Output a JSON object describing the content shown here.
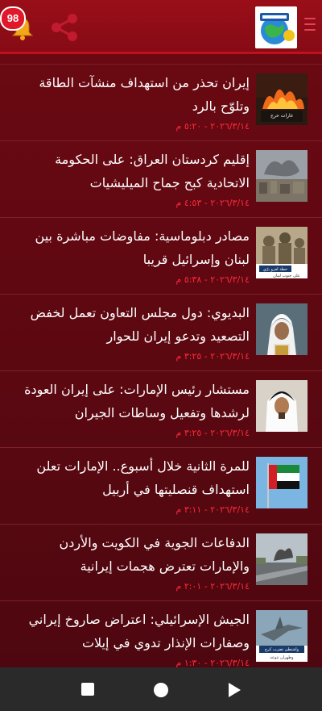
{
  "header": {
    "notifications_count": "98",
    "logo_label": "logo"
  },
  "news": [
    {
      "title": "إيران تحذر من استهداف منشآت الطاقة وتلوّح بالرد",
      "date": "٢٠٢٦/٣/١٤ - ٥:٢٠ م",
      "thumb": "fire-scene",
      "thumb_caption": "غارات حرج"
    },
    {
      "title": "إقليم كردستان العراق: على الحكومة الاتحادية كبح جماح الميليشيات",
      "date": "٢٠٢٦/٣/١٤ - ٤:٥٣ م",
      "thumb": "smoke-city"
    },
    {
      "title": "مصادر دبلوماسية: مفاوضات مباشرة بين لبنان وإسرائيل قريبا",
      "date": "٢٠٢٦/٣/١٤ - ٥:٣٨ م",
      "thumb": "soldiers",
      "thumb_caption": "خطة لغزو برّي",
      "thumb_caption2": "على جنوب لبنان"
    },
    {
      "title": "البديوي: دول مجلس التعاون تعمل لخفض التصعيد وتدعو إيران للحوار",
      "date": "٢٠٢٦/٣/١٤ - ٣:٢٥ م",
      "thumb": "portrait-ghutra"
    },
    {
      "title": "مستشار رئيس الإمارات: على إيران العودة لرشدها وتفعيل وساطات الجيران",
      "date": "٢٠٢٦/٣/١٤ - ٣:٢٥ م",
      "thumb": "portrait-white"
    },
    {
      "title": "للمرة الثانية خلال أسبوع.. الإمارات تعلن استهداف قنصليتها في أربيل",
      "date": "٢٠٢٦/٣/١٤ - ٣:١١ م",
      "thumb": "uae-flag"
    },
    {
      "title": "الدفاعات الجوية في الكويت والأردن والإمارات تعترض هجمات إيرانية",
      "date": "٢٠٢٦/٣/١٤ - ٢:٠١ م",
      "thumb": "highway-smoke"
    },
    {
      "title": "الجيش الإسرائيلي: اعتراض صاروخ إيراني وصفارات الإنذار تدوي في إيلات",
      "date": "٢٠٢٦/٣/١٤ - ١:٣٠ م",
      "thumb": "jet",
      "thumb_caption": "واشنطن تضرب كرج",
      "thumb_caption2": "وطهران تتوعد"
    }
  ],
  "colors": {
    "header": "#8e0c16",
    "date": "#ff2a3a",
    "divider": "#7c2029"
  }
}
